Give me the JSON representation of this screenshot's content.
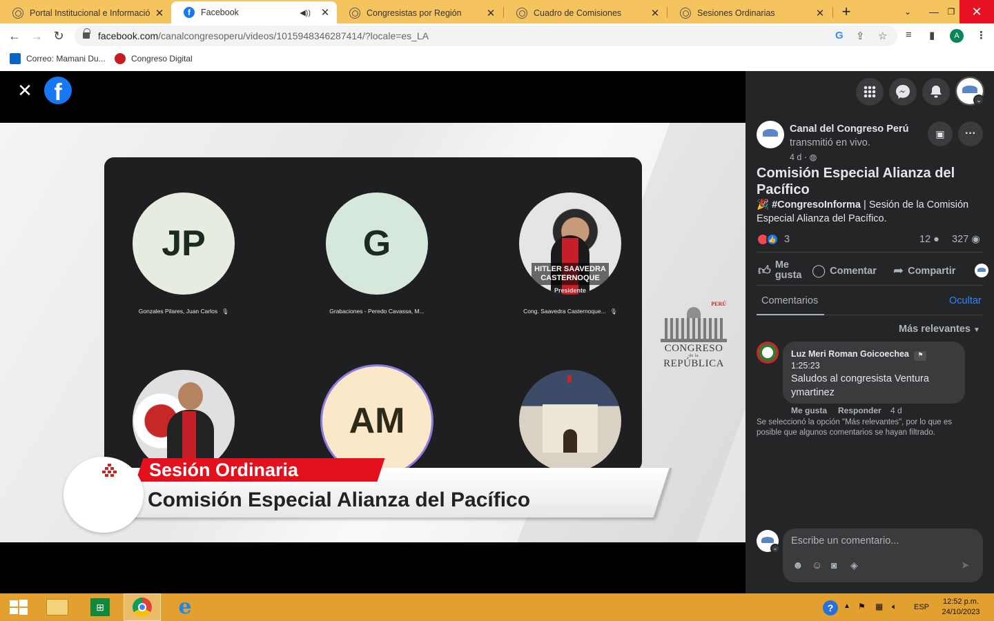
{
  "browser": {
    "tabs": [
      {
        "title": "Portal Institucional e Información"
      },
      {
        "title": "Facebook"
      },
      {
        "title": "Congresistas por Región"
      },
      {
        "title": "Cuadro de Comisiones"
      },
      {
        "title": "Sesiones Ordinarias"
      }
    ],
    "url_host": "facebook.com",
    "url_path": "/canalcongresoperu/videos/1015948346287414/?locale=es_LA",
    "profile_initial": "A",
    "bookmarks": [
      {
        "label": "Correo: Mamani Du..."
      },
      {
        "label": "Congreso Digital"
      }
    ]
  },
  "video": {
    "participants": [
      {
        "initials": "JP",
        "label": "Gonzales Pilares, Juan Carlos"
      },
      {
        "initials": "G",
        "label": "Grabaciones - Peredo Cavassa, M..."
      },
      {
        "photo_name": "HITLER SAAVEDRA CASTERNOQUE",
        "photo_role": "Presidente",
        "label": "Cong. Saavedra Casternoque..."
      },
      {
        "initials": "AM"
      }
    ],
    "logo": {
      "top": "PERÚ",
      "line1": "CONGRESO",
      "small": "de la",
      "line2": "REPÚBLICA"
    },
    "lower_third": {
      "kicker": "Sesión Ordinaria",
      "title": "Comisión Especial Alianza del Pacífico"
    }
  },
  "post": {
    "page_name": "Canal del Congreso Perú",
    "action": "transmitió en vivo.",
    "time": "4 d ·",
    "title": "Comisión Especial Alianza del Pacífico",
    "hashtag": "#CongresoInforma",
    "desc": " | Sesión de la Comisión Especial Alianza del Pacífico.",
    "reactions_count": "3",
    "comments_count": "12",
    "views_count": "327",
    "actions": {
      "like": "Me gusta",
      "comment": "Comentar",
      "share": "Compartir"
    },
    "comments_tab": "Comentarios",
    "hide": "Ocultar",
    "sort": "Más relevantes",
    "comment": {
      "author": "Luz Meri Roman Goicoechea",
      "timestamp": "1:25:23",
      "text": "Saludos al congresista Ventura ymartinez",
      "like": "Me gusta",
      "reply": "Responder",
      "age": "4 d"
    },
    "filter_note": "Se seleccionó la opción \"Más relevantes\", por lo que es posible que algunos comentarios se hayan filtrado.",
    "composer_placeholder": "Escribe un comentario..."
  },
  "taskbar": {
    "lang": "ESP",
    "time": "12:52 p.m.",
    "date": "24/10/2023"
  },
  "colors": {
    "tabstrip": "#f5c45e",
    "taskbar": "#e2a12f",
    "facebook_blue": "#1877f2",
    "panel_bg": "#242526",
    "accent_link": "#2d88ff"
  }
}
